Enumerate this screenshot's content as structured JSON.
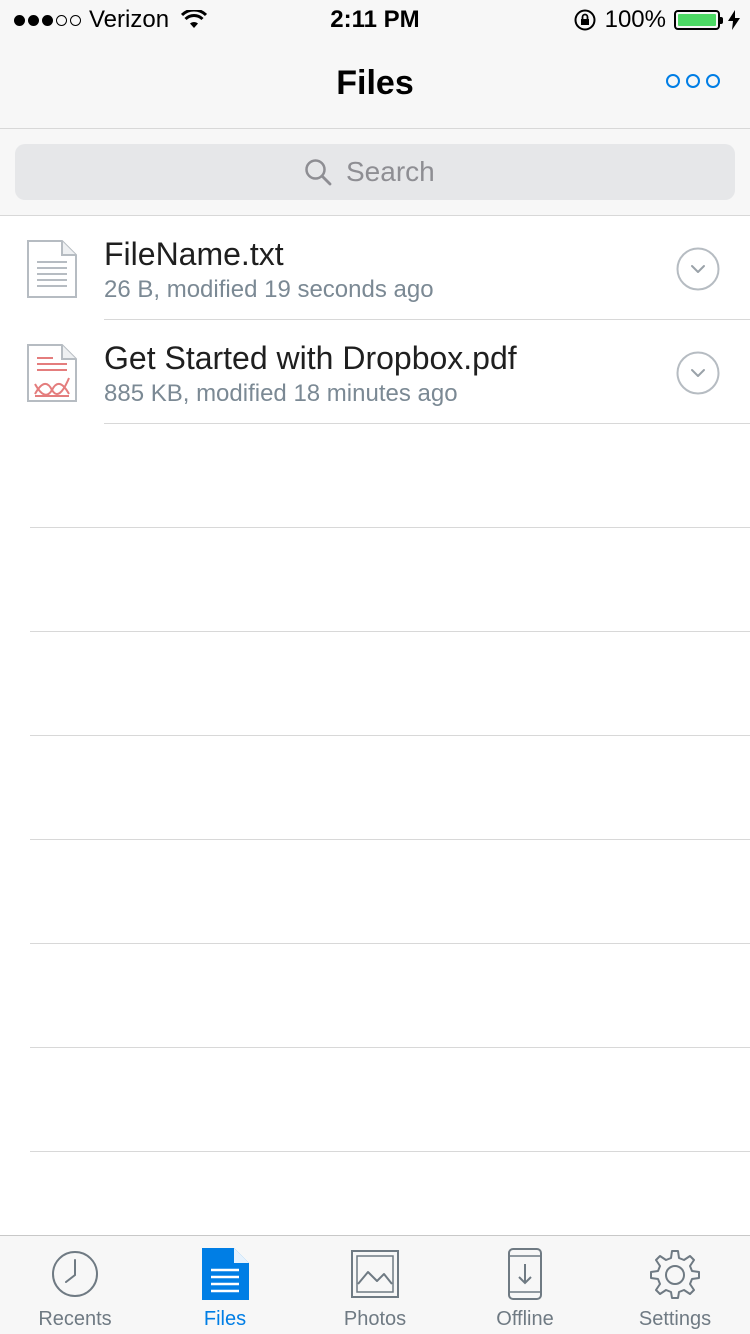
{
  "status_bar": {
    "carrier": "Verizon",
    "time": "2:11 PM",
    "battery": "100%",
    "battery_level": 1.0,
    "signal_bars": 3,
    "signal_total": 5
  },
  "nav": {
    "title": "Files",
    "more_icon": "ellipsis-icon"
  },
  "search": {
    "placeholder": "Search"
  },
  "files": [
    {
      "name": "FileName.txt",
      "meta": "26 B, modified 19 seconds ago",
      "icon": "text-file-icon"
    },
    {
      "name": "Get Started with Dropbox.pdf",
      "meta": "885 KB, modified 18 minutes ago",
      "icon": "pdf-file-icon"
    }
  ],
  "tabs": [
    {
      "label": "Recents",
      "icon": "clock-icon",
      "active": false
    },
    {
      "label": "Files",
      "icon": "files-icon",
      "active": true
    },
    {
      "label": "Photos",
      "icon": "photos-icon",
      "active": false
    },
    {
      "label": "Offline",
      "icon": "offline-icon",
      "active": false
    },
    {
      "label": "Settings",
      "icon": "gear-icon",
      "active": false
    }
  ],
  "colors": {
    "accent": "#007ee5",
    "battery": "#4cd964",
    "pdf": "#e47d7d"
  }
}
